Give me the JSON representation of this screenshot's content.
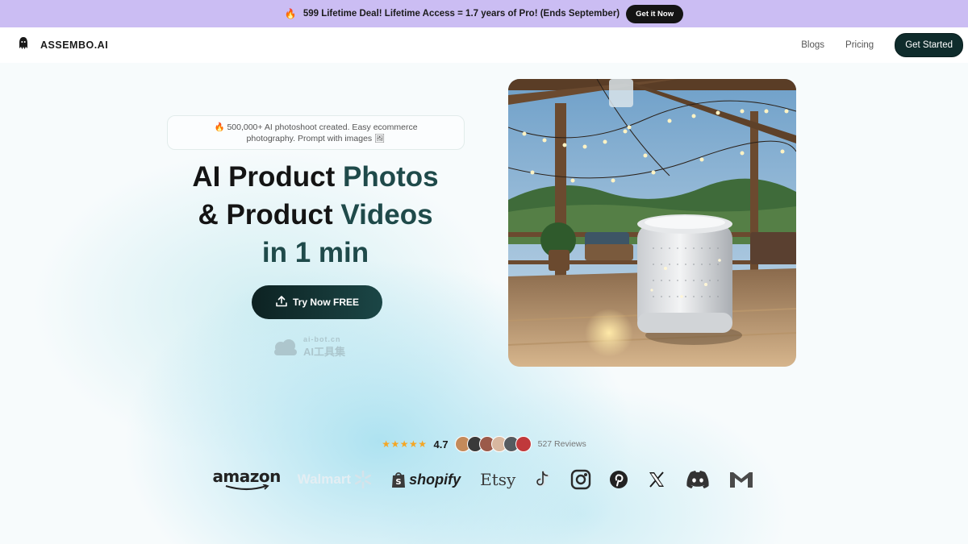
{
  "promo": {
    "text": "599 Lifetime Deal! Lifetime Access = 1.7 years of Pro! (Ends September)",
    "button": "Get it Now"
  },
  "nav": {
    "brand": "ASSEMBO.AI",
    "links": [
      "Blogs",
      "Pricing"
    ],
    "cta": "Get Started"
  },
  "hero": {
    "pill_text": "500,000+ AI photoshoot created. Easy ecommerce photography. Prompt with images",
    "headline_line1_plain": "AI Product ",
    "headline_line1_accent": "Photos",
    "headline_line2_plain": "& Product ",
    "headline_line2_accent": "Videos",
    "headline_line3": "in 1 min",
    "try_button": "Try Now FREE"
  },
  "watermark": {
    "line1": "ai-bot.cn",
    "line2": "AI工具集"
  },
  "reviews": {
    "stars": "★★★★★",
    "rating": "4.7",
    "count": "527 Reviews"
  },
  "logos": {
    "amazon": "amazon",
    "walmart": "Walmart",
    "shopify": "shopify",
    "etsy": "Etsy"
  },
  "colors": {
    "promo_bg": "#cbbdf3",
    "accent_dark": "#0f2c2c",
    "headline_accent": "#1f4a4a",
    "star": "#f5a623"
  }
}
